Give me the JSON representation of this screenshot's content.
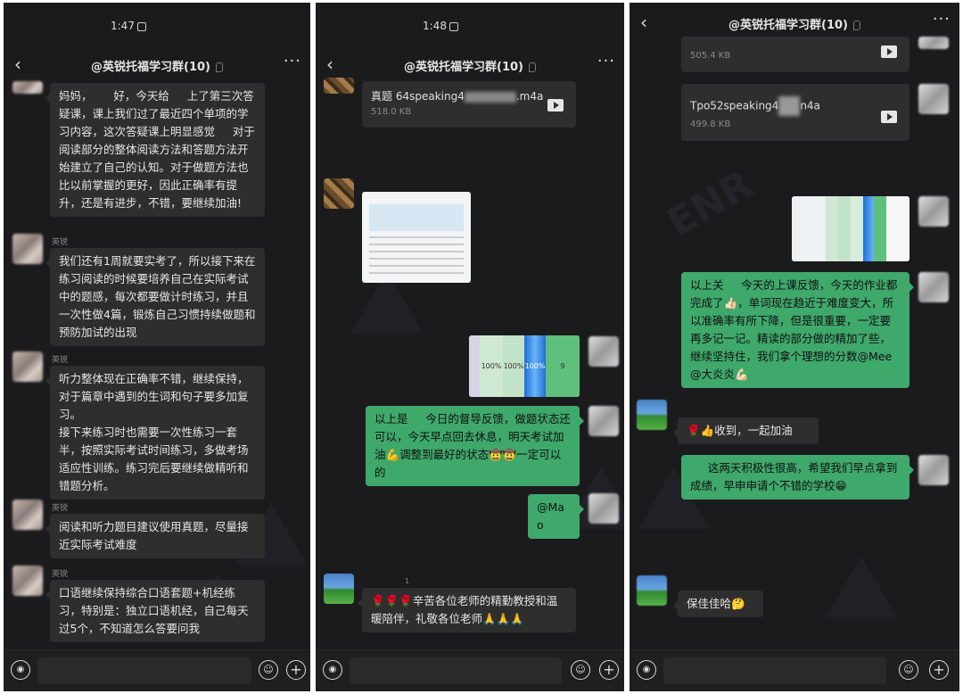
{
  "panel1": {
    "time": "1:47",
    "title": "@英锐托福学习群(10)",
    "messages": [
      {
        "text": "妈妈，      好，今天给     上了第三次答疑课，课上我们过了最近四个单项的学习内容，这次答疑课上明显感觉     对于阅读部分的整体阅读方法和答题方法开始建立了自己的认知。对于做题方法也比以前掌握的更好，因此正确率有提升，还是有进步，不错，要继续加油!"
      },
      {
        "name": "英锐",
        "text": "我们还有1周就要实考了，所以接下来在练习阅读的时候要培养自己在实际考试中的题感，每次都要做计时练习，并且一次性做4篇，锻炼自己习惯持续做题和预防加试的出现"
      },
      {
        "name": "英锐",
        "text": "听力整体现在正确率不错，继续保持，对于篇章中遇到的生词和句子要多加复习。\n接下来练习时也需要一次性练习一套半，按照实际考试时间练习，多做考场适应性训练。练习完后要继续做精听和错题分析。"
      },
      {
        "name": "英锐",
        "text": "阅读和听力题目建议使用真题，尽量接近实际考试难度"
      },
      {
        "name": "英锐",
        "text": "口语继续保持综合口语套题+机经练习，特别是：独立口语机经，自己每天过5个，不知道怎么答要问我"
      }
    ]
  },
  "panel2": {
    "time": "1:48",
    "title": "@英锐托福学习群(10)",
    "file": {
      "name_prefix": "真题 64speaking4",
      "name_suffix": ".m4a",
      "size": "518.0 KB"
    },
    "score_cells": [
      "100%",
      "100%",
      "100%",
      "9"
    ],
    "feedback": "以上是     今日的督导反馈，做题状态还可以，今天早点回去休息，明天考试加油💪调整到最好的状态🤠🤠一定可以的",
    "mention": "@Mao",
    "thanks": "🌹🌹🌹辛苦各位老师的精勤教授和温暖陪伴，礼敬各位老师🙏🙏🙏",
    "tiny_label": "1"
  },
  "panel3": {
    "title": "@英锐托福学习群(10)",
    "file_top_size": "505.4 KB",
    "file": {
      "name_prefix": "Tpo52speaking4",
      "name_suffix": "n4a",
      "size": "499.8 KB"
    },
    "feedback": "以上关     今天的上课反馈，今天的作业都完成了👍🏻，单词现在趋近于难度变大，所以准确率有所下降，但是很重要，一定要再多记一记。精读的部分做的精加了些，继续坚持住，我们拿个理想的分数@Mee @大炎炎💪🏻",
    "reply1": "🌹👍收到，一起加油",
    "reply2": "     这两天积极性很高，希望我们早点拿到成绩，早申申请个不错的学校😁",
    "reply3": "保佳佳哈🤔"
  },
  "icons": {
    "back": "chevron-left-icon",
    "more": "more-dots-icon",
    "voice": "voice-icon",
    "emoji": "emoji-icon",
    "plus": "plus-icon",
    "video": "video-file-icon"
  },
  "colors": {
    "background": "#1b1b1d",
    "bubble_incoming": "#2e2e2e",
    "bubble_outgoing": "#3fa86b"
  }
}
